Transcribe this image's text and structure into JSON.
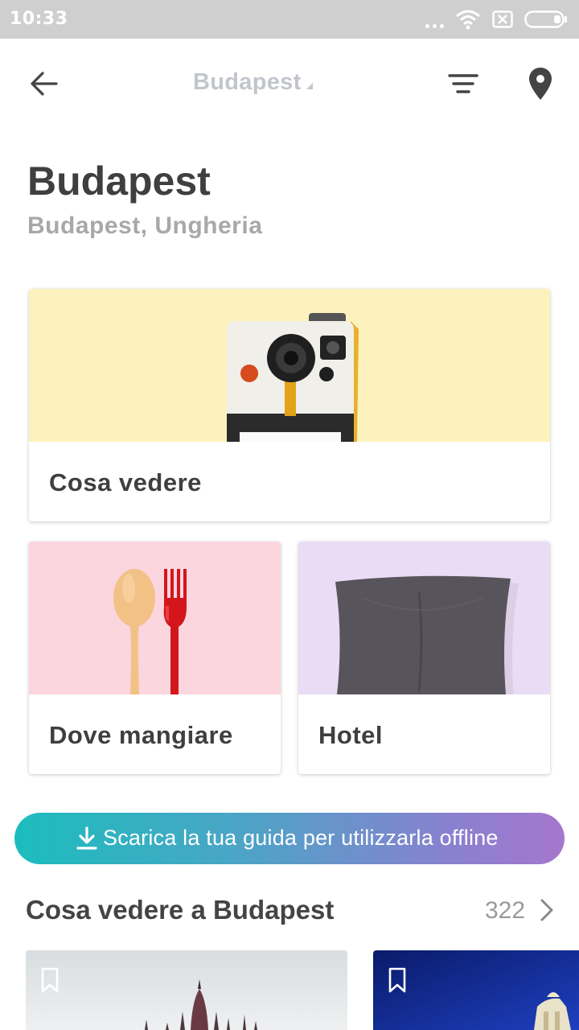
{
  "status_bar": {
    "time": "10:33",
    "icons": [
      "more-dots-icon",
      "wifi-icon",
      "no-sim-icon",
      "battery-icon"
    ]
  },
  "app_bar": {
    "title": "Budapest",
    "icons": [
      "back-arrow-icon",
      "filter-icon",
      "location-pin-icon"
    ]
  },
  "header": {
    "city": "Budapest",
    "subtitle": "Budapest, Ungheria"
  },
  "categories": [
    {
      "label": "Cosa vedere",
      "image": "polaroid-camera",
      "bg": "#fdf2bd"
    },
    {
      "label": "Dove mangiare",
      "image": "spoon-and-fork",
      "bg": "#fbd6df"
    },
    {
      "label": "Hotel",
      "image": "pillow",
      "bg": "#eadcf5"
    }
  ],
  "offline_banner": {
    "label": "Scarica la tua guida per utilizzarla offline",
    "icon": "download-icon",
    "gradient": [
      "#1bbdbd",
      "#a577cc"
    ]
  },
  "section": {
    "title": "Cosa vedere a Budapest",
    "count": "322",
    "chevron": "chevron-right-icon"
  },
  "places": [
    {
      "image": "parliament-building",
      "bookmark_icon": "bookmark-icon"
    },
    {
      "image": "night-building",
      "bookmark_icon": "bookmark-icon"
    }
  ]
}
